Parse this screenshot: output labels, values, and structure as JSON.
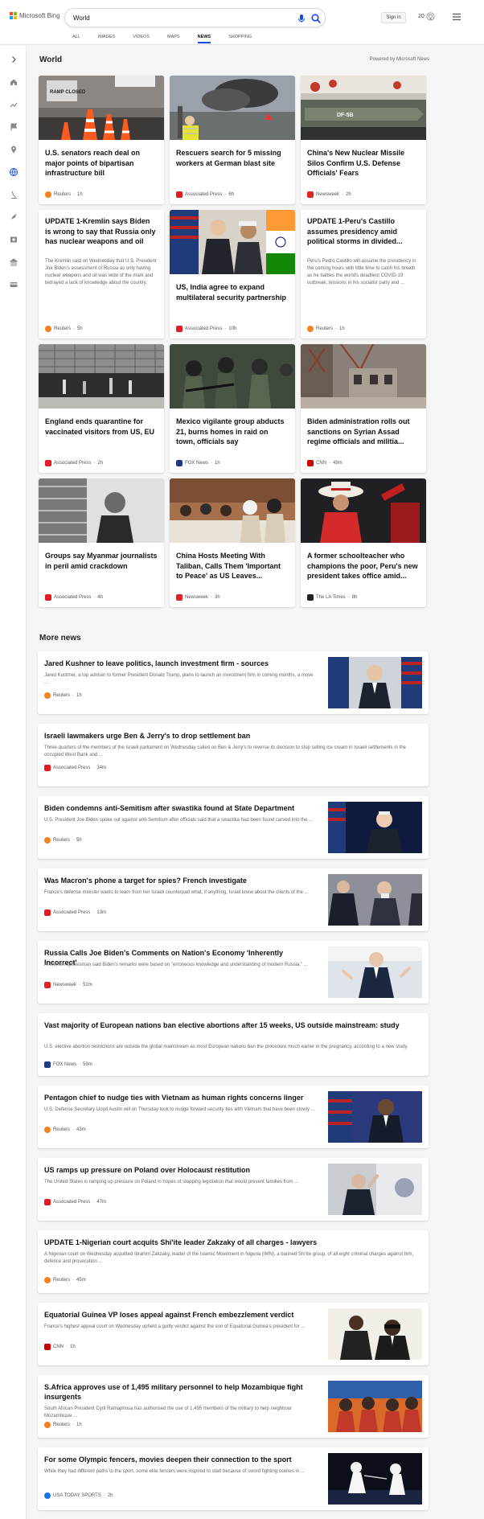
{
  "header": {
    "brand": "Microsoft Bing",
    "search_value": "World",
    "signin_label": "Sign in",
    "rewards_count": "20"
  },
  "tabs": [
    "ALL",
    "IMAGES",
    "VIDEOS",
    "MAPS",
    "NEWS",
    "SHOPPING"
  ],
  "active_tab": "NEWS",
  "section": {
    "title": "World",
    "powered_by": "Powered by Microsoft News"
  },
  "cards": [
    {
      "title": "U.S. senators reach deal on major points of bipartisan infrastructure bill",
      "source": "Reuters",
      "time": "1h",
      "badge": "R",
      "badge_color": "#f5821f",
      "image_text": "RAMP CLOSED"
    },
    {
      "title": "Rescuers search for 5 missing workers at German blast site",
      "source": "Associated Press",
      "time": "6h",
      "badge": "AP",
      "badge_color": "#e21a22"
    },
    {
      "title": "China's New Nuclear Missile Silos Confirm U.S. Defense Officials' Fears",
      "source": "Newsweek",
      "time": "2h",
      "badge": "N",
      "badge_color": "#e02424",
      "image_text": "DF-5B"
    },
    {
      "title": "UPDATE 1-Kremlin says Biden is wrong to say that Russia only has nuclear weapons and oil",
      "desc": "The Kremlin said on Wednesday that U.S. President Joe Biden's assessment of Russia as only having nuclear weapons and oil was wide of the mark and betrayed a lack of knowledge about the country.",
      "source": "Reuters",
      "time": "5h",
      "badge": "R",
      "badge_color": "#f5821f"
    },
    {
      "title": "US, India agree to expand multilateral security partnership",
      "source": "Associated Press",
      "time": "10h",
      "badge": "AP",
      "badge_color": "#e21a22"
    },
    {
      "title": "UPDATE 1-Peru's Castillo assumes presidency amid political storms in divided...",
      "desc": "Peru's Pedro Castillo will assume the presidency in the coming hours with little time to catch his breath as he battles the world's deadliest COVID-19 outbreak, tensions in his socialist party and ...",
      "source": "Reuters",
      "time": "1h",
      "badge": "R",
      "badge_color": "#f5821f"
    },
    {
      "title": "England ends quarantine for vaccinated visitors from US, EU",
      "source": "Associated Press",
      "time": "2h",
      "badge": "AP",
      "badge_color": "#e21a22"
    },
    {
      "title": "Mexico vigilante group abducts 21, burns homes in raid on town, officials say",
      "source": "FOX News",
      "time": "1h",
      "badge": "F",
      "badge_color": "#1b3a8c"
    },
    {
      "title": "Biden administration rolls out sanctions on Syrian Assad regime officials and militia...",
      "source": "CNN",
      "time": "49m",
      "badge": "C",
      "badge_color": "#cc0000"
    },
    {
      "title": "Groups say Myanmar journalists in peril amid crackdown",
      "source": "Associated Press",
      "time": "4h",
      "badge": "AP",
      "badge_color": "#e21a22"
    },
    {
      "title": "China Hosts Meeting With Taliban, Calls Them 'Important to Peace' as US Leaves...",
      "source": "Newsweek",
      "time": "3h",
      "badge": "N",
      "badge_color": "#e02424"
    },
    {
      "title": "A former schoolteacher who champions the poor, Peru's new president takes office amid...",
      "source": "The LA Times",
      "time": "8h",
      "badge": "L",
      "badge_color": "#222222"
    }
  ],
  "more_title": "More news",
  "more": [
    {
      "title": "Jared Kushner to leave politics, launch investment firm - sources",
      "desc": "Jared Kushner, a top adviser to former President Donald Trump, plans to launch an investment firm in coming months, a move ...",
      "source": "Reuters",
      "time": "1h",
      "badge": "R",
      "badge_color": "#f5821f"
    },
    {
      "title": "Israeli lawmakers urge Ben & Jerry's to drop settlement ban",
      "desc": "Three-quarters of the members of the Israeli parliament on Wednesday called on Ben & Jerry's to reverse its decision to stop selling ice cream in Israeli settlements in the occupied West Bank and ...",
      "source": "Associated Press",
      "time": "34m",
      "badge": "AP",
      "badge_color": "#e21a22"
    },
    {
      "title": "Biden condemns anti-Semitism after swastika found at State Department",
      "desc": "U.S. President Joe Biden spoke out against anti-Semitism after officials said that a swastika had been found carved into the ...",
      "source": "Reuters",
      "time": "5h",
      "badge": "R",
      "badge_color": "#f5821f"
    },
    {
      "title": "Was Macron's phone a target for spies? French investigate",
      "desc": "France's defense minister wants to learn from her Israeli counterpart what, if anything, Israel knew about the clients of the ...",
      "source": "Associated Press",
      "time": "13m",
      "badge": "AP",
      "badge_color": "#e21a22"
    },
    {
      "title": "Russia Calls Joe Biden's Comments on Nation's Economy 'Inherently Incorrect'",
      "desc": "A Kremlin spokesman said Biden's remarks were based on \"erroneous knowledge and understanding of modern Russia.\" ...",
      "source": "Newsweek",
      "time": "51m",
      "badge": "N",
      "badge_color": "#e02424"
    },
    {
      "title": "Vast majority of European nations ban elective abortions after 15 weeks, US outside mainstream: study",
      "desc": "U.S. elective abortion restrictions are outside the global mainstream as most European nations ban the procedure much earlier in the pregnancy, according to a new study.",
      "source": "FOX News",
      "time": "59m",
      "badge": "F",
      "badge_color": "#1b3a8c"
    },
    {
      "title": "Pentagon chief to nudge ties with Vietnam as human rights concerns linger",
      "desc": "U.S. Defense Secretary Lloyd Austin will on Thursday look to nudge forward security ties with Vietnam that have been slowly ...",
      "source": "Reuters",
      "time": "43m",
      "badge": "R",
      "badge_color": "#f5821f"
    },
    {
      "title": "US ramps up pressure on Poland over Holocaust restitution",
      "desc": "The United States is ramping up pressure on Poland in hopes of stopping legislation that would prevent families from ...",
      "source": "Associated Press",
      "time": "47m",
      "badge": "AP",
      "badge_color": "#e21a22"
    },
    {
      "title": "UPDATE 1-Nigerian court acquits Shi'ite leader Zakzaky of all charges - lawyers",
      "desc": "A Nigerian court on Wednesday acquitted Ibrahim Zakzaky, leader of the Islamic Movement in Nigeria (IMN), a banned Shi'ite group, of all eight criminal charges against him, defence and prosecution ...",
      "source": "Reuters",
      "time": "45m",
      "badge": "R",
      "badge_color": "#f5821f"
    },
    {
      "title": "Equatorial Guinea VP loses appeal against French embezzlement verdict",
      "desc": "France's highest appeal court on Wednesday upheld a guilty verdict against the son of Equatorial Guinea's president for ...",
      "source": "CNN",
      "time": "1h",
      "badge": "C",
      "badge_color": "#cc0000"
    },
    {
      "title": "S.Africa approves use of 1,495 military personnel to help Mozambique fight insurgents",
      "desc": "South African President Cyril Ramaphosa has authorised the use of 1,495 members of the military to help neighbour Mozambique ...",
      "source": "Reuters",
      "time": "1h",
      "badge": "R",
      "badge_color": "#f5821f"
    },
    {
      "title": "For some Olympic fencers, movies deepen their connection to the sport",
      "desc": "While they had different paths to the sport, some elite fencers were inspired to start because of sword fighting scenes in ...",
      "source": "USA TODAY SPORTS",
      "time": "2h",
      "badge": "U",
      "badge_color": "#1a73e8"
    }
  ],
  "colors": {
    "accent": "#174ae4",
    "bg": "#f5f5f5"
  }
}
